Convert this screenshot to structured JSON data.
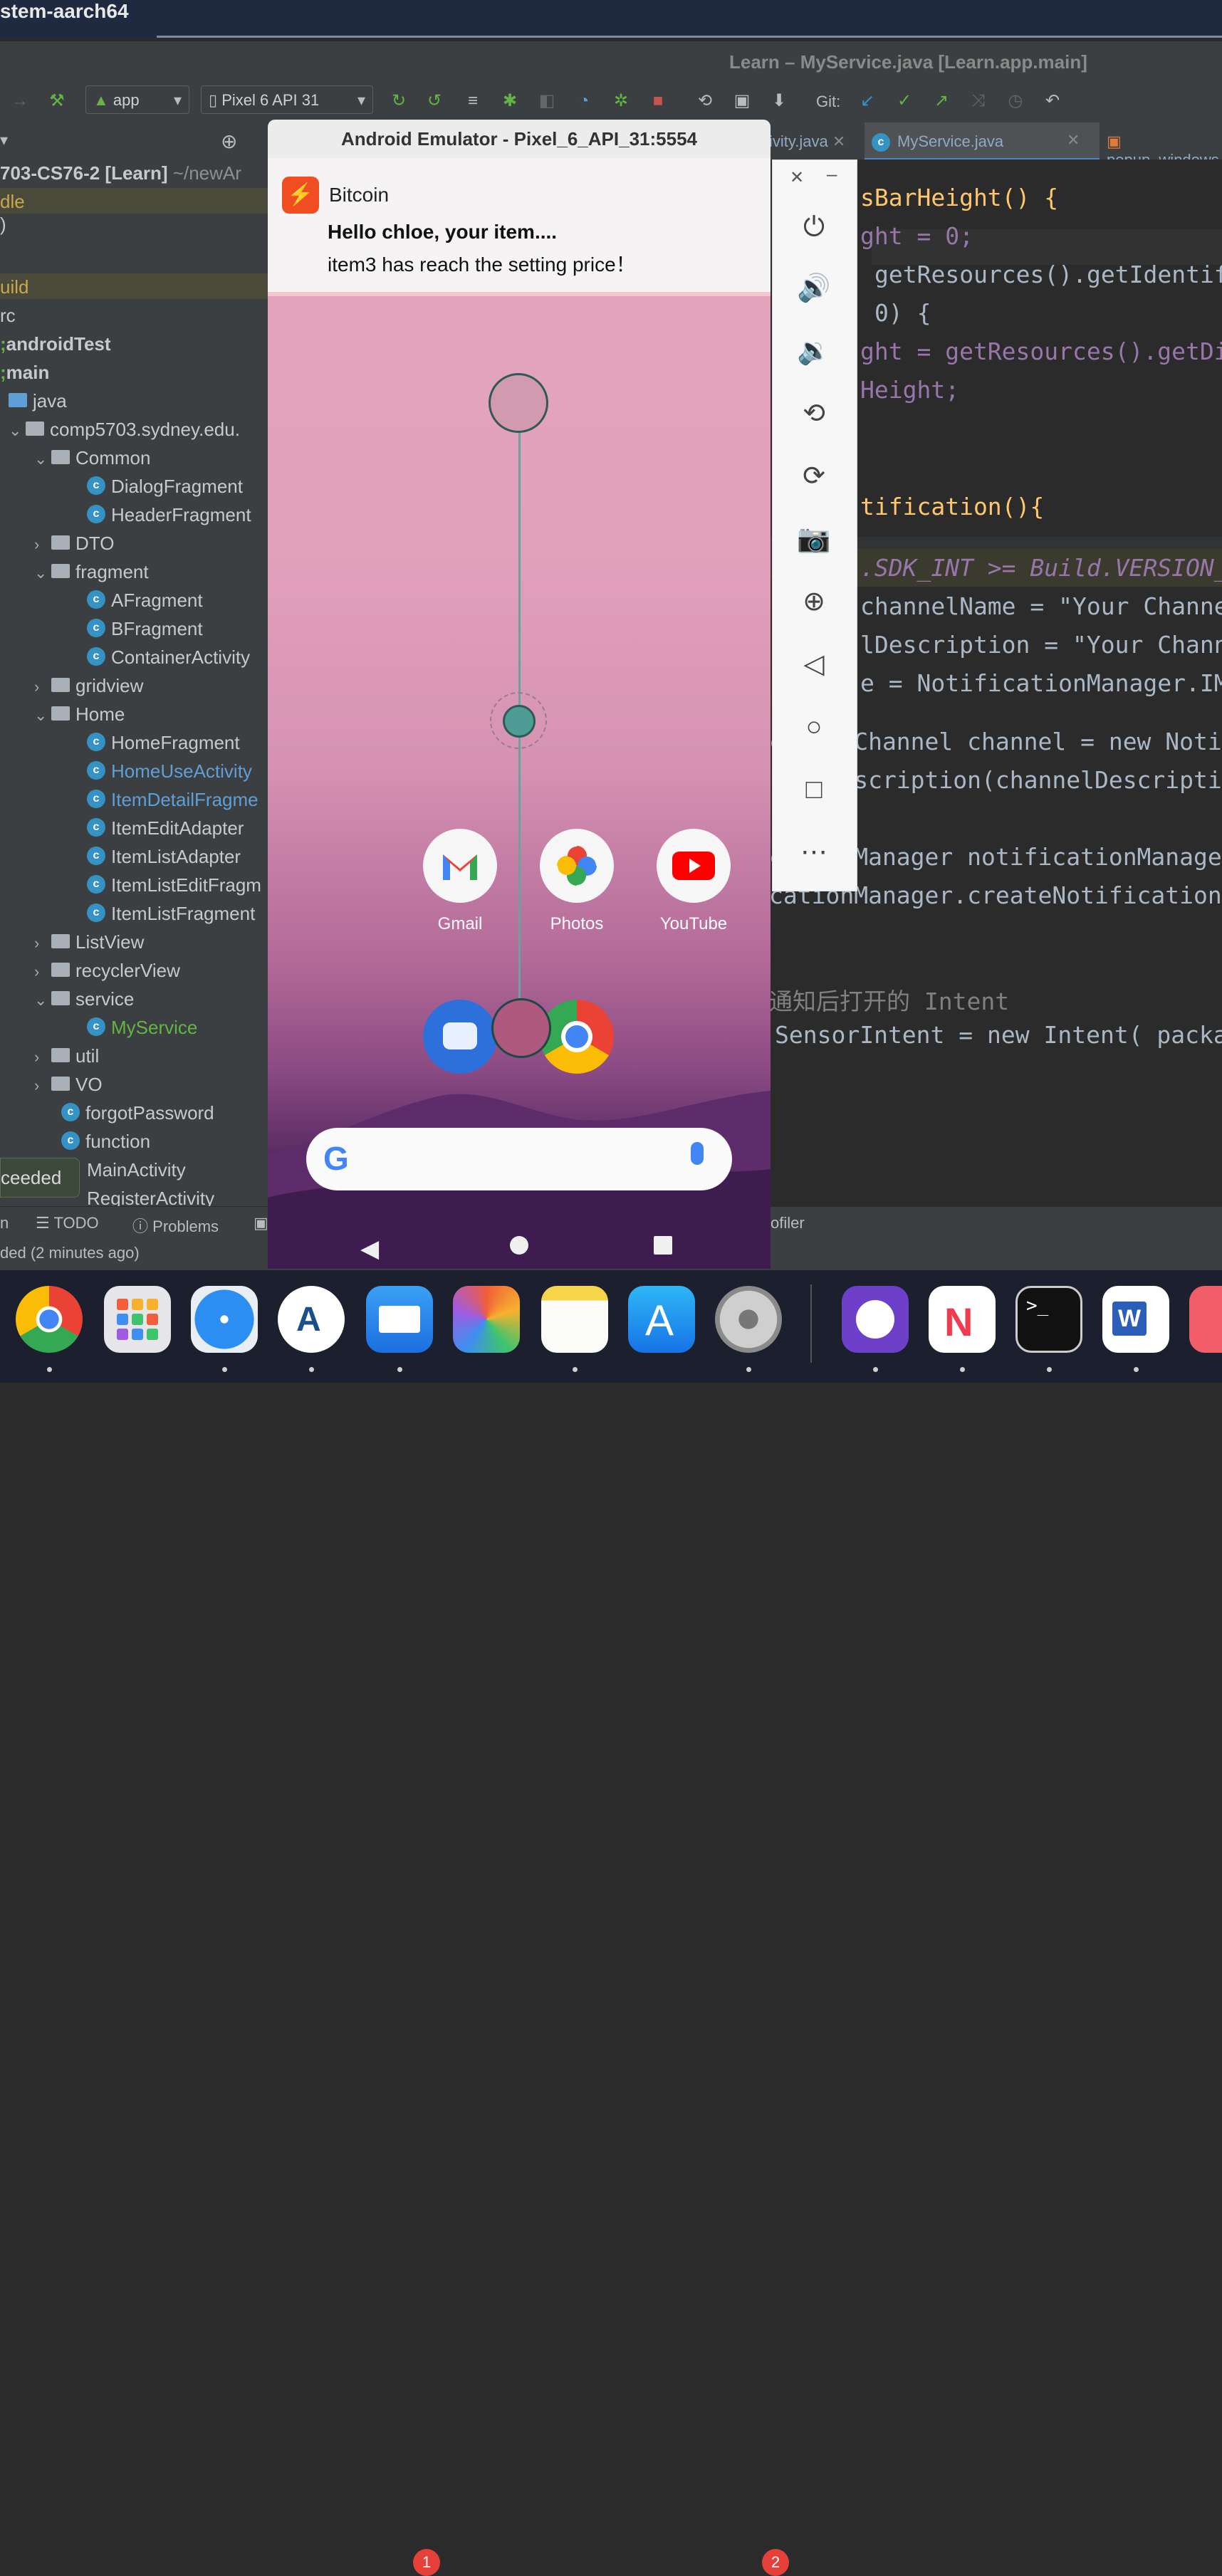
{
  "system": {
    "host_title": "stem-aarch64"
  },
  "ide": {
    "window_title": "Learn – MyService.java [Learn.app.main]",
    "toolbar": {
      "run_config": "app",
      "device": "Pixel 6 API 31",
      "git_label": "Git:"
    },
    "project_header": "703-CS76-2 [Learn]",
    "project_path": "~/newAr",
    "tree": {
      "dle": "dle",
      "c": ")",
      "build": "uild",
      "src": "rc",
      "androidTest": "androidTest",
      "main": "main",
      "java": "java",
      "package": "comp5703.sydney.edu.",
      "common": "Common",
      "dialog": "DialogFragment",
      "header": "HeaderFragment",
      "dto": "DTO",
      "fragment": "fragment",
      "afrag": "AFragment",
      "bfrag": "BFragment",
      "container": "ContainerActivity",
      "gridview": "gridview",
      "home": "Home",
      "homefrag": "HomeFragment",
      "homeuse": "HomeUseActivity",
      "itemdetail": "ItemDetailFragme",
      "itemedit": "ItemEditAdapter",
      "itemlistadapter": "ItemListAdapter",
      "itemlistedit": "ItemListEditFragm",
      "itemlistfrag": "ItemListFragment",
      "listview": "ListView",
      "recycler": "recyclerView",
      "service": "service",
      "myservice": "MyService",
      "util": "util",
      "vo": "VO",
      "forgot": "forgotPassword",
      "function": "function",
      "main_activity": "MainActivity",
      "register": "RegisterActivity"
    },
    "tabs": {
      "activity": "ivity.java",
      "myservice": "MyService.java",
      "popup": "popup_windows.xn"
    },
    "code_lines": [
      "sBarHeight() {",
      "ght = 0;",
      "getResources().getIdentifi",
      "0) {",
      "ght = getResources().getDim",
      "Height;",
      "tification(){",
      ".SDK_INT >= Build.VERSION_C",
      "channelName = \"Your Channel",
      "lDescription = \"Your Channe",
      "e = NotificationManager.IMP",
      "cationChannel channel = new Notifi",
      ".setDescription(channelDescriptic",
      "cationManager notificationManager",
      "cationManager.createNotificationCh",
      "通知后打开的 Intent",
      "SensorIntent = new Intent( packa"
    ],
    "status": {
      "build_pill": "ceeded",
      "n": "n",
      "todo": "TODO",
      "problems": "Problems",
      "profiler": "ofiler",
      "footer": "ded (2 minutes ago)"
    }
  },
  "emulator": {
    "title": "Android Emulator - Pixel_6_API_31:5554",
    "notification": {
      "app": "Bitcoin",
      "title": "Hello chloe, your item....",
      "body": "item3 has reach the setting price！"
    },
    "apps": [
      {
        "label": "Gmail"
      },
      {
        "label": "Photos"
      },
      {
        "label": "YouTube"
      }
    ],
    "side_icons": [
      "power-icon",
      "volume-up-icon",
      "volume-down-icon",
      "rotate-left-icon",
      "rotate-right-icon",
      "camera-icon",
      "zoom-icon",
      "back-icon",
      "home-icon",
      "overview-icon",
      "more-icon"
    ]
  },
  "dock": {
    "badges": {
      "mail": "1",
      "settings": "2"
    }
  },
  "colors": {
    "ide_bg": "#2b2b2b",
    "panel": "#3c3f41",
    "accent_blue": "#3592c4",
    "class_link": "#5f9fd6"
  }
}
